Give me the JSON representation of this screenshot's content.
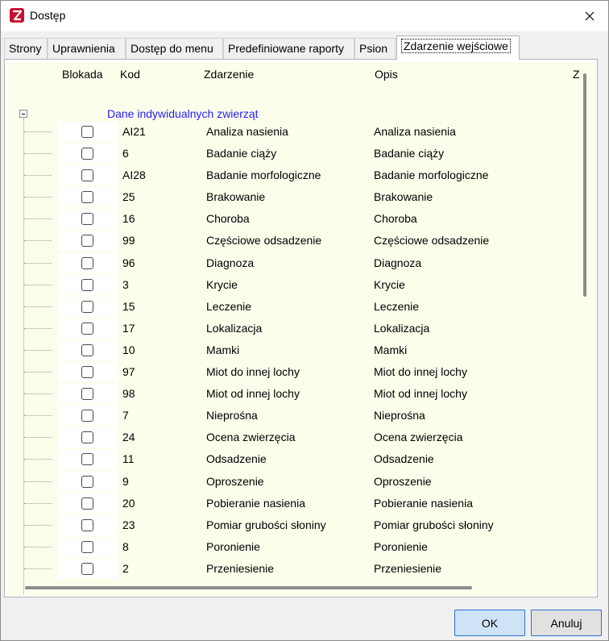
{
  "window": {
    "title": "Dostęp"
  },
  "tabs": [
    {
      "label": "Strony"
    },
    {
      "label": "Uprawnienia"
    },
    {
      "label": "Dostęp do menu"
    },
    {
      "label": "Predefiniowane raporty"
    },
    {
      "label": "Psion"
    },
    {
      "label": "Zdarzenie wejściowe",
      "active": true
    }
  ],
  "grid": {
    "columns": {
      "blokada": "Blokada",
      "kod": "Kod",
      "zdarzenie": "Zdarzenie",
      "opis": "Opis",
      "extra": "Z"
    },
    "group_label": "Dane indywidualnych zwierząt",
    "rows": [
      {
        "kod": "AI21",
        "zdarzenie": "Analiza nasienia",
        "opis": "Analiza nasienia"
      },
      {
        "kod": "6",
        "zdarzenie": "Badanie ciąży",
        "opis": "Badanie ciąży"
      },
      {
        "kod": "AI28",
        "zdarzenie": "Badanie morfologiczne",
        "opis": "Badanie morfologiczne"
      },
      {
        "kod": "25",
        "zdarzenie": "Brakowanie",
        "opis": "Brakowanie"
      },
      {
        "kod": "16",
        "zdarzenie": "Choroba",
        "opis": "Choroba"
      },
      {
        "kod": "99",
        "zdarzenie": "Częściowe odsadzenie",
        "opis": "Częściowe odsadzenie"
      },
      {
        "kod": "96",
        "zdarzenie": "Diagnoza",
        "opis": "Diagnoza"
      },
      {
        "kod": "3",
        "zdarzenie": "Krycie",
        "opis": "Krycie"
      },
      {
        "kod": "15",
        "zdarzenie": "Leczenie",
        "opis": "Leczenie"
      },
      {
        "kod": "17",
        "zdarzenie": "Lokalizacja",
        "opis": "Lokalizacja"
      },
      {
        "kod": "10",
        "zdarzenie": "Mamki",
        "opis": "Mamki"
      },
      {
        "kod": "97",
        "zdarzenie": "Miot do innej lochy",
        "opis": "Miot do innej lochy"
      },
      {
        "kod": "98",
        "zdarzenie": "Miot od innej lochy",
        "opis": "Miot od innej lochy"
      },
      {
        "kod": "7",
        "zdarzenie": "Nieprośna",
        "opis": "Nieprośna"
      },
      {
        "kod": "24",
        "zdarzenie": "Ocena zwierzęcia",
        "opis": "Ocena zwierzęcia"
      },
      {
        "kod": "11",
        "zdarzenie": "Odsadzenie",
        "opis": "Odsadzenie"
      },
      {
        "kod": "9",
        "zdarzenie": "Oproszenie",
        "opis": "Oproszenie"
      },
      {
        "kod": "20",
        "zdarzenie": "Pobieranie nasienia",
        "opis": "Pobieranie nasienia"
      },
      {
        "kod": "23",
        "zdarzenie": "Pomiar grubości słoniny",
        "opis": "Pomiar grubości słoniny"
      },
      {
        "kod": "8",
        "zdarzenie": "Poronienie",
        "opis": "Poronienie"
      },
      {
        "kod": "2",
        "zdarzenie": "Przeniesienie",
        "opis": "Przeniesienie"
      }
    ]
  },
  "buttons": {
    "ok": "OK",
    "cancel": "Anuluj"
  },
  "colors": {
    "grid_background": "#fdfdec",
    "group_label": "#1f1fff",
    "app_icon": "#c8102e",
    "ok_button": "#cfe3f7"
  }
}
